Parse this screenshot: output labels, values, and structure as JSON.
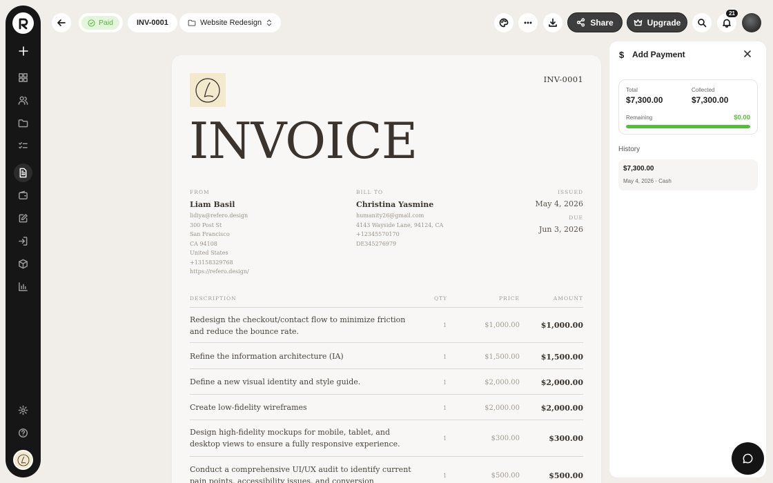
{
  "topbar": {
    "status_label": "Paid",
    "invoice_id": "INV-0001",
    "project_name": "Website Redesign",
    "share_label": "Share",
    "upgrade_label": "Upgrade",
    "notification_count": "21"
  },
  "invoice": {
    "number": "INV-0001",
    "title": "INVOICE",
    "from": {
      "label": "FROM",
      "name": "Liam Basil",
      "lines": [
        "lidiya@refero.design",
        "300 Post St",
        "San Francisco",
        "CA 94108",
        "United States",
        "+13158329768",
        "https://refero.design/"
      ]
    },
    "bill_to": {
      "label": "BILL TO",
      "name": "Christina Yasmine",
      "lines": [
        "humanity26@gmail.com",
        "4143 Wayside Lane, 94124, CA",
        "+12345570170",
        "DE345276979"
      ]
    },
    "issued_label": "ISSUED",
    "issued_date": "May 4, 2026",
    "due_label": "DUE",
    "due_date": "Jun 3, 2026",
    "columns": {
      "description": "DESCRIPTION",
      "qty": "QTY",
      "price": "PRICE",
      "amount": "AMOUNT"
    },
    "items": [
      {
        "description": "Redesign the checkout/contact flow to minimize friction and reduce the bounce rate.",
        "qty": "1",
        "price": "$1,000.00",
        "amount": "$1,000.00"
      },
      {
        "description": "Refine the information architecture (IA)",
        "qty": "1",
        "price": "$1,500.00",
        "amount": "$1,500.00"
      },
      {
        "description": "Define a new visual identity and style guide.",
        "qty": "1",
        "price": "$2,000.00",
        "amount": "$2,000.00"
      },
      {
        "description": "Create low-fidelity wireframes",
        "qty": "1",
        "price": "$2,000.00",
        "amount": "$2,000.00"
      },
      {
        "description": "Design high-fidelity mockups for mobile, tablet, and desktop views to ensure a fully responsive experience.",
        "qty": "1",
        "price": "$300.00",
        "amount": "$300.00"
      },
      {
        "description": "Conduct a comprehensive UI/UX audit to identify current pain points, accessibility issues, and conversion bottlenecks.",
        "qty": "1",
        "price": "$500.00",
        "amount": "$500.00"
      }
    ]
  },
  "payment": {
    "title": "Add Payment",
    "total_label": "Total",
    "total_value": "$7,300.00",
    "collected_label": "Collected",
    "collected_value": "$7,300.00",
    "remaining_label": "Remaining",
    "remaining_value": "$0.00",
    "collected_fraction": 1.0,
    "history_label": "History",
    "history": [
      {
        "amount": "$7,300.00",
        "meta": "May 4, 2026 · Cash"
      }
    ]
  },
  "colors": {
    "accent_green": "#4fc133",
    "sidebar_bg": "#161616",
    "page_bg": "#f1eee9"
  },
  "icons": {
    "sidebar": [
      "dashboard-icon",
      "users-icon",
      "folder-icon",
      "tasks-icon",
      "invoice-icon",
      "wallet-icon",
      "edit-icon",
      "import-icon",
      "box-icon",
      "chart-icon",
      "settings-icon",
      "help-icon"
    ]
  }
}
